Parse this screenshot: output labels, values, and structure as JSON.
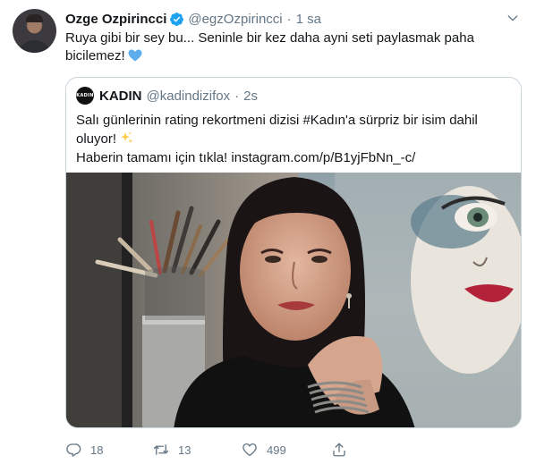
{
  "tweet": {
    "author": {
      "display_name": "Ozge Ozpirincci",
      "handle": "@egzOzpirincci",
      "verified": true
    },
    "separator": "·",
    "time": "1 sa",
    "text": "Ruya gibi bir sey bu... Seninle bir kez daha ayni seti paylasmak paha bicilemez!",
    "emoji": "blue-heart-emoji",
    "menu_icon": "chevron-down-icon"
  },
  "quoted_tweet": {
    "author": {
      "display_name": "KADIN",
      "handle": "@kadindizifox",
      "avatar_text": "KADIN"
    },
    "separator": "·",
    "time": "2s",
    "line1": "Salı günlerinin rating rekortmeni dizisi #Kadın'a sürpriz bir isim dahil oluyor!",
    "line2": "Haberin tamamı için tıkla! instagram.com/p/B1yjFbNn_-c/",
    "emoji": "sparkles-emoji",
    "media": "photo-woman-with-paintings"
  },
  "actions": {
    "reply": {
      "icon": "reply-icon",
      "count": "18"
    },
    "retweet": {
      "icon": "retweet-icon",
      "count": "13"
    },
    "like": {
      "icon": "heart-icon",
      "count": "499"
    },
    "share": {
      "icon": "share-icon"
    }
  },
  "colors": {
    "text": "#14171a",
    "secondary": "#657786",
    "border": "#ccd6dd",
    "verified_blue": "#1da1f2",
    "emoji_blue": "#5dadec",
    "sparkle_yellow": "#ffcc4d"
  }
}
